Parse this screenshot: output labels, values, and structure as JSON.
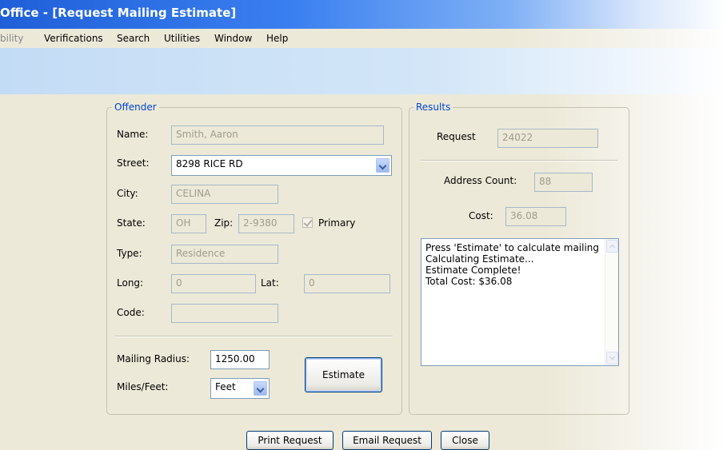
{
  "window": {
    "title": "Office - [Request Mailing Estimate]"
  },
  "menu": {
    "items": [
      "bility",
      "Verifications",
      "Search",
      "Utilities",
      "Window",
      "Help"
    ]
  },
  "offender": {
    "legend": "Offender",
    "name_label": "Name:",
    "name_value": "Smith, Aaron",
    "street_label": "Street:",
    "street_value": "8298 RICE RD",
    "city_label": "City:",
    "city_value": "CELINA",
    "state_label": "State:",
    "state_value": "OH",
    "zip_label": "Zip:",
    "zip_value": "2-9380",
    "primary_label": "Primary",
    "type_label": "Type:",
    "type_value": "Residence",
    "long_label": "Long:",
    "long_value": "0",
    "lat_label": "Lat:",
    "lat_value": "0",
    "code_label": "Code:",
    "code_value": ""
  },
  "mailing": {
    "radius_label": "Mailing Radius:",
    "radius_value": "1250.00",
    "units_label": "Miles/Feet:",
    "units_value": "Feet",
    "estimate_button": "Estimate"
  },
  "results": {
    "legend": "Results",
    "request_label": "Request",
    "request_value": "24022",
    "address_count_label": "Address Count:",
    "address_count_value": "88",
    "cost_label": "Cost:",
    "cost_value": "36.08",
    "log": [
      "Press 'Estimate' to calculate mailing",
      "Calculating Estimate...",
      "Estimate Complete!",
      "Total Cost: $36.08"
    ]
  },
  "footer": {
    "print_button": "Print Request",
    "email_button": "Email Request",
    "close_button": "Close"
  },
  "icons": {
    "dropdown": "chevron-down-icon",
    "checkbox": "checkmark-icon"
  }
}
